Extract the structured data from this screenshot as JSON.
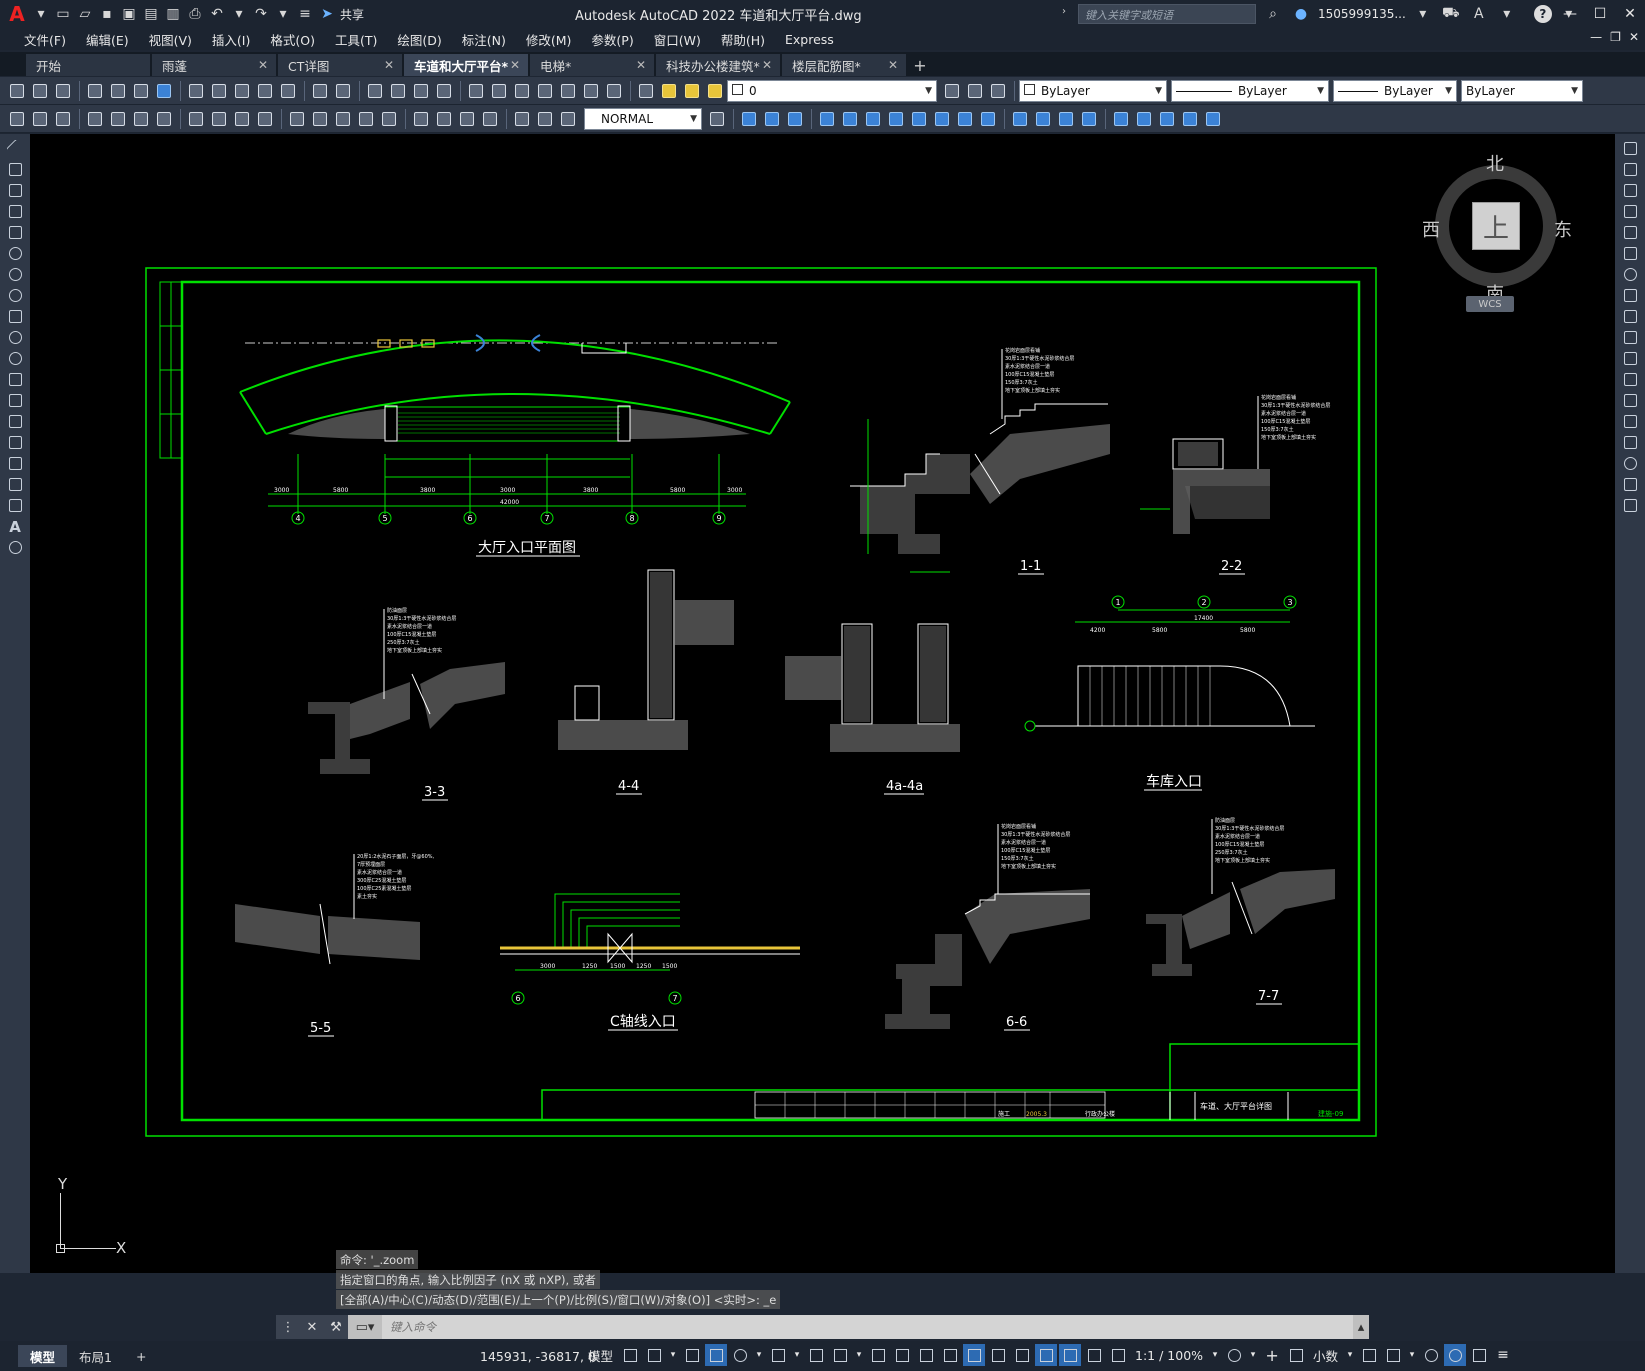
{
  "app": {
    "title": "Autodesk AutoCAD 2022    车道和大厅平台.dwg",
    "logo": "A",
    "share_label": "共享",
    "search_placeholder": "键入关键字或短语",
    "user_name": "1505999135...",
    "help_label": "?"
  },
  "menu": {
    "items": [
      "文件(F)",
      "编辑(E)",
      "视图(V)",
      "插入(I)",
      "格式(O)",
      "工具(T)",
      "绘图(D)",
      "标注(N)",
      "修改(M)",
      "参数(P)",
      "窗口(W)",
      "帮助(H)",
      "Express"
    ]
  },
  "tabs": {
    "items": [
      {
        "label": "开始",
        "active": false
      },
      {
        "label": "雨蓬",
        "active": false
      },
      {
        "label": "CT详图",
        "active": false
      },
      {
        "label": "车道和大厅平台*",
        "active": true
      },
      {
        "label": "电梯*",
        "active": false
      },
      {
        "label": "科技办公楼建筑*",
        "active": false
      },
      {
        "label": "楼层配筋图*",
        "active": false
      }
    ],
    "new_tab_label": "+"
  },
  "toolbar": {
    "layer_value": "0",
    "color_value": "ByLayer",
    "linetype_value": "ByLayer",
    "lineweight_value": "ByLayer",
    "plotstyle_value": "ByLayer",
    "dimstyle_value": "NORMAL"
  },
  "viewcube": {
    "north": "北",
    "south": "南",
    "east": "东",
    "west": "西",
    "top": "上",
    "wcs_label": "WCS"
  },
  "ucs": {
    "x_label": "X",
    "y_label": "Y"
  },
  "drawing": {
    "titles": {
      "lobby_plan": "大厅入口平面图",
      "sec_1_1": "1-1",
      "sec_2_2": "2-2",
      "sec_3_3": "3-3",
      "sec_4_4": "4-4",
      "sec_4a_4a": "4a-4a",
      "garage_entrance": "车库入口",
      "sec_5_5": "5-5",
      "c_axis_entrance": "C轴线入口",
      "sec_6_6": "6-6",
      "sec_7_7": "7-7"
    },
    "axis_bubbles_plan": [
      "4",
      "5",
      "6",
      "7",
      "8",
      "9"
    ],
    "axis_bubbles_garage": [
      "1",
      "2",
      "3"
    ],
    "axis_bubbles_c": [
      "6",
      "7"
    ],
    "plan_dims": [
      "3000",
      "5800",
      "3800",
      "3000",
      "3800",
      "5800",
      "3000"
    ],
    "plan_total": "42000",
    "garage_dims": [
      "4200",
      "5800",
      "5800"
    ],
    "garage_total": "17400",
    "c_dims": [
      "3000",
      "1250",
      "1500",
      "1250",
      "1500"
    ],
    "titleblock": {
      "drawing_name": "车道、大厅平台详图",
      "drawing_no": "建施-09",
      "stage": "施工",
      "date": "2005.3",
      "project": "行政办公楼"
    }
  },
  "command": {
    "history": [
      "命令: '_.zoom",
      "指定窗口的角点, 输入比例因子 (nX 或 nXP), 或者",
      "[全部(A)/中心(C)/动态(D)/范围(E)/上一个(P)/比例(S)/窗口(W)/对象(O)] <实时>: _e"
    ],
    "input_placeholder": "键入命令"
  },
  "status": {
    "layout_tabs": [
      {
        "label": "模型",
        "active": true
      },
      {
        "label": "布局1",
        "active": false
      }
    ],
    "add_layout": "+",
    "coordinates": "145931, -36817, 0",
    "model_label": "模型",
    "scale": "1:1 / 100%",
    "units": "小数"
  }
}
